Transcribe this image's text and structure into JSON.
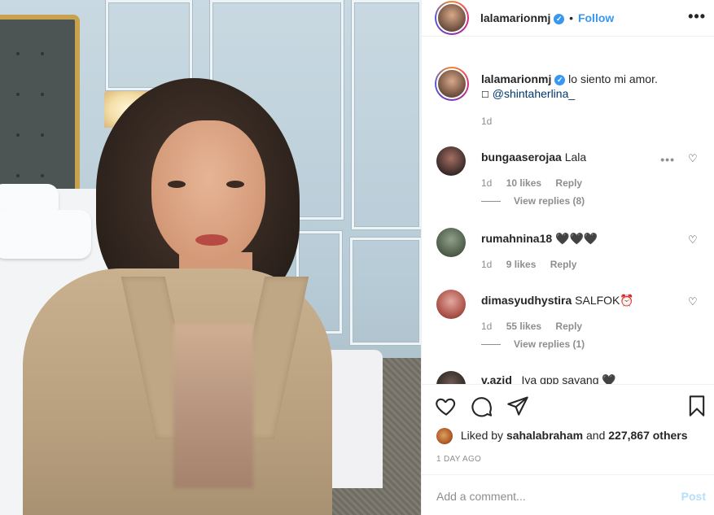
{
  "header": {
    "username": "lalamarionmj",
    "separator": "•",
    "follow_label": "Follow",
    "more_icon": "more-dots-icon"
  },
  "caption": {
    "username": "lalamarionmj",
    "text": "lo siento mi amor.",
    "mention_prefix": "☐",
    "mention": "@shintaherlina_",
    "time": "1d"
  },
  "comments": [
    {
      "username": "bungaaserojaa",
      "text": "Lala",
      "time": "1d",
      "likes": "10 likes",
      "reply": "Reply",
      "view_replies": "View replies (8)"
    },
    {
      "username": "rumahnina18",
      "text": "🖤🖤🖤",
      "time": "1d",
      "likes": "9 likes",
      "reply": "Reply",
      "view_replies": ""
    },
    {
      "username": "dimasyudhystira",
      "text": "SALFOK⏰",
      "time": "1d",
      "likes": "55 likes",
      "reply": "Reply",
      "view_replies": "View replies (1)"
    },
    {
      "username": "v.azid_",
      "text": "Iya gpp sayang 🖤",
      "time": "",
      "likes": "",
      "reply": "",
      "view_replies": ""
    }
  ],
  "actions": {
    "liked_by_prefix": "Liked by",
    "liked_by_user": "sahalabraham",
    "liked_by_and": "and",
    "liked_by_count": "227,867 others",
    "time_ago": "1 DAY AGO",
    "add_comment_placeholder": "Add a comment...",
    "post_label": "Post"
  },
  "colors": {
    "link_blue": "#3897f0",
    "text": "#262626",
    "muted": "#8e8e8e",
    "post_disabled": "#b2dffc"
  }
}
